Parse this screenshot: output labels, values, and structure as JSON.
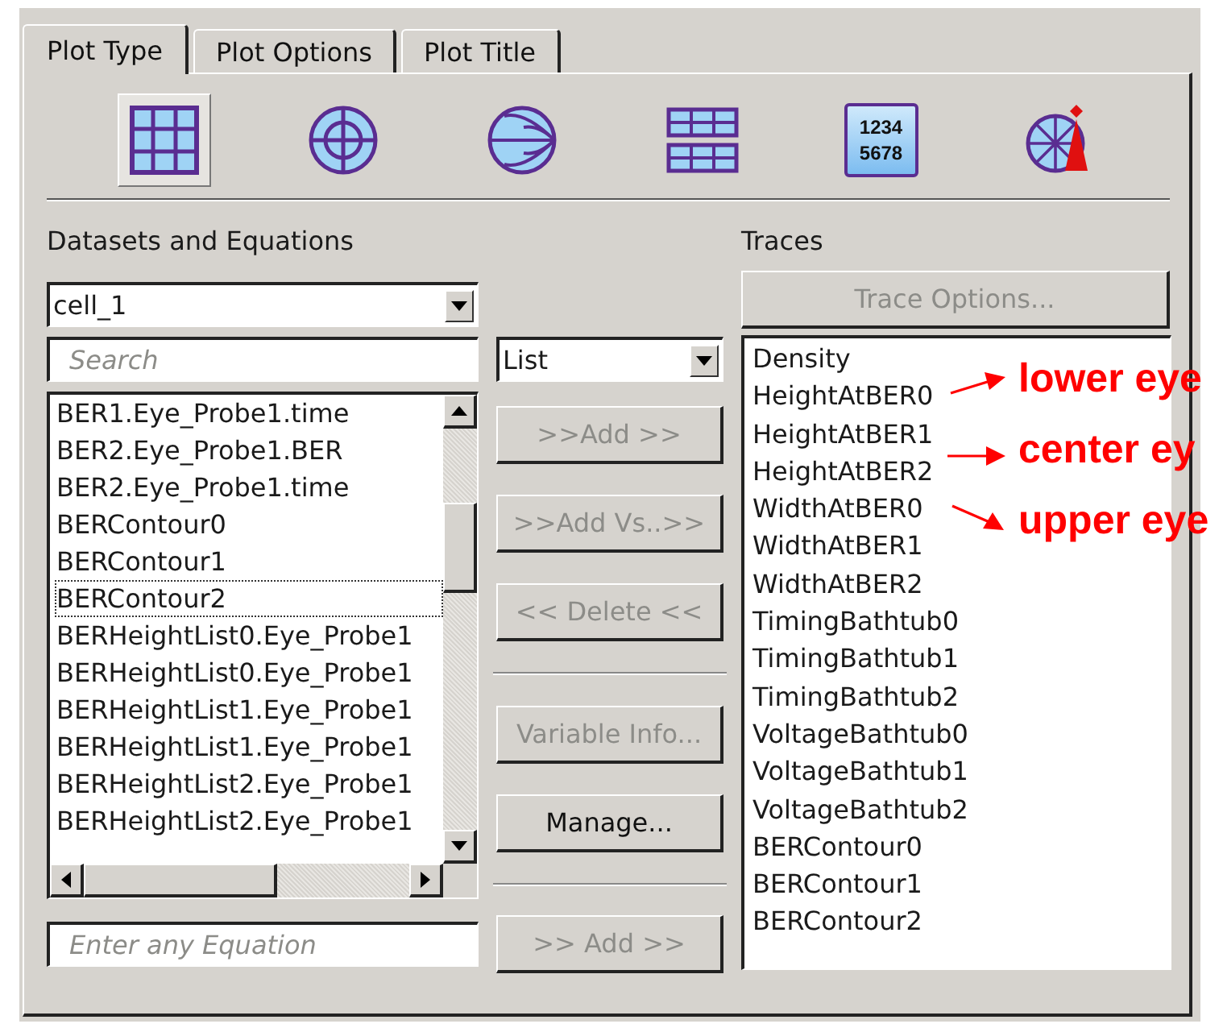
{
  "tabs": [
    {
      "label": "Plot Type",
      "selected": true
    },
    {
      "label": "Plot Options",
      "selected": false
    },
    {
      "label": "Plot Title",
      "selected": false
    }
  ],
  "plot_types": [
    {
      "kind": "rectangular",
      "selected": true
    },
    {
      "kind": "polar",
      "selected": false
    },
    {
      "kind": "smith",
      "selected": false
    },
    {
      "kind": "tabular",
      "selected": false
    },
    {
      "kind": "numeric",
      "selected": false,
      "label": [
        "1234",
        "5678"
      ]
    },
    {
      "kind": "antenna",
      "selected": false
    }
  ],
  "datasets": {
    "title": "Datasets and Equations",
    "source": "cell_1",
    "search": {
      "placeholder": "Search"
    },
    "view": "List",
    "items": [
      {
        "text": "BER1.Eye_Probe1.time",
        "current": false
      },
      {
        "text": "BER2.Eye_Probe1.BER",
        "current": false
      },
      {
        "text": "BER2.Eye_Probe1.time",
        "current": false
      },
      {
        "text": "BERContour0",
        "current": false
      },
      {
        "text": "BERContour1",
        "current": false
      },
      {
        "text": "BERContour2",
        "current": true
      },
      {
        "text": "BERHeightList0.Eye_Probe1",
        "current": false
      },
      {
        "text": "BERHeightList0.Eye_Probe1",
        "current": false
      },
      {
        "text": "BERHeightList1.Eye_Probe1",
        "current": false
      },
      {
        "text": "BERHeightList1.Eye_Probe1",
        "current": false
      },
      {
        "text": "BERHeightList2.Eye_Probe1",
        "current": false
      },
      {
        "text": "BERHeightList2.Eye_Probe1",
        "current": false
      }
    ],
    "equation": {
      "placeholder": "Enter any Equation"
    },
    "equation_button": {
      "label": ">> Add >>",
      "disabled": true
    }
  },
  "actions": [
    {
      "kind": "button",
      "label": ">>Add >>",
      "disabled": true
    },
    {
      "kind": "button",
      "label": ">>Add Vs..>>",
      "disabled": true
    },
    {
      "kind": "button",
      "label": "<< Delete <<",
      "disabled": true
    },
    {
      "kind": "separator"
    },
    {
      "kind": "button",
      "label": "Variable Info...",
      "disabled": true
    },
    {
      "kind": "button",
      "label": "Manage...",
      "disabled": false
    }
  ],
  "traces": {
    "title": "Traces",
    "options_button": {
      "label": "Trace Options...",
      "disabled": true
    },
    "items": [
      "Density",
      "HeightAtBER0",
      "HeightAtBER1",
      "HeightAtBER2",
      "WidthAtBER0",
      "WidthAtBER1",
      "WidthAtBER2",
      "TimingBathtub0",
      "TimingBathtub1",
      "TimingBathtub2",
      "VoltageBathtub0",
      "VoltageBathtub1",
      "VoltageBathtub2",
      "BERContour0",
      "BERContour1",
      "BERContour2"
    ]
  },
  "annotations": [
    {
      "text": "lower eye"
    },
    {
      "text": "center ey"
    },
    {
      "text": "upper eye"
    }
  ]
}
